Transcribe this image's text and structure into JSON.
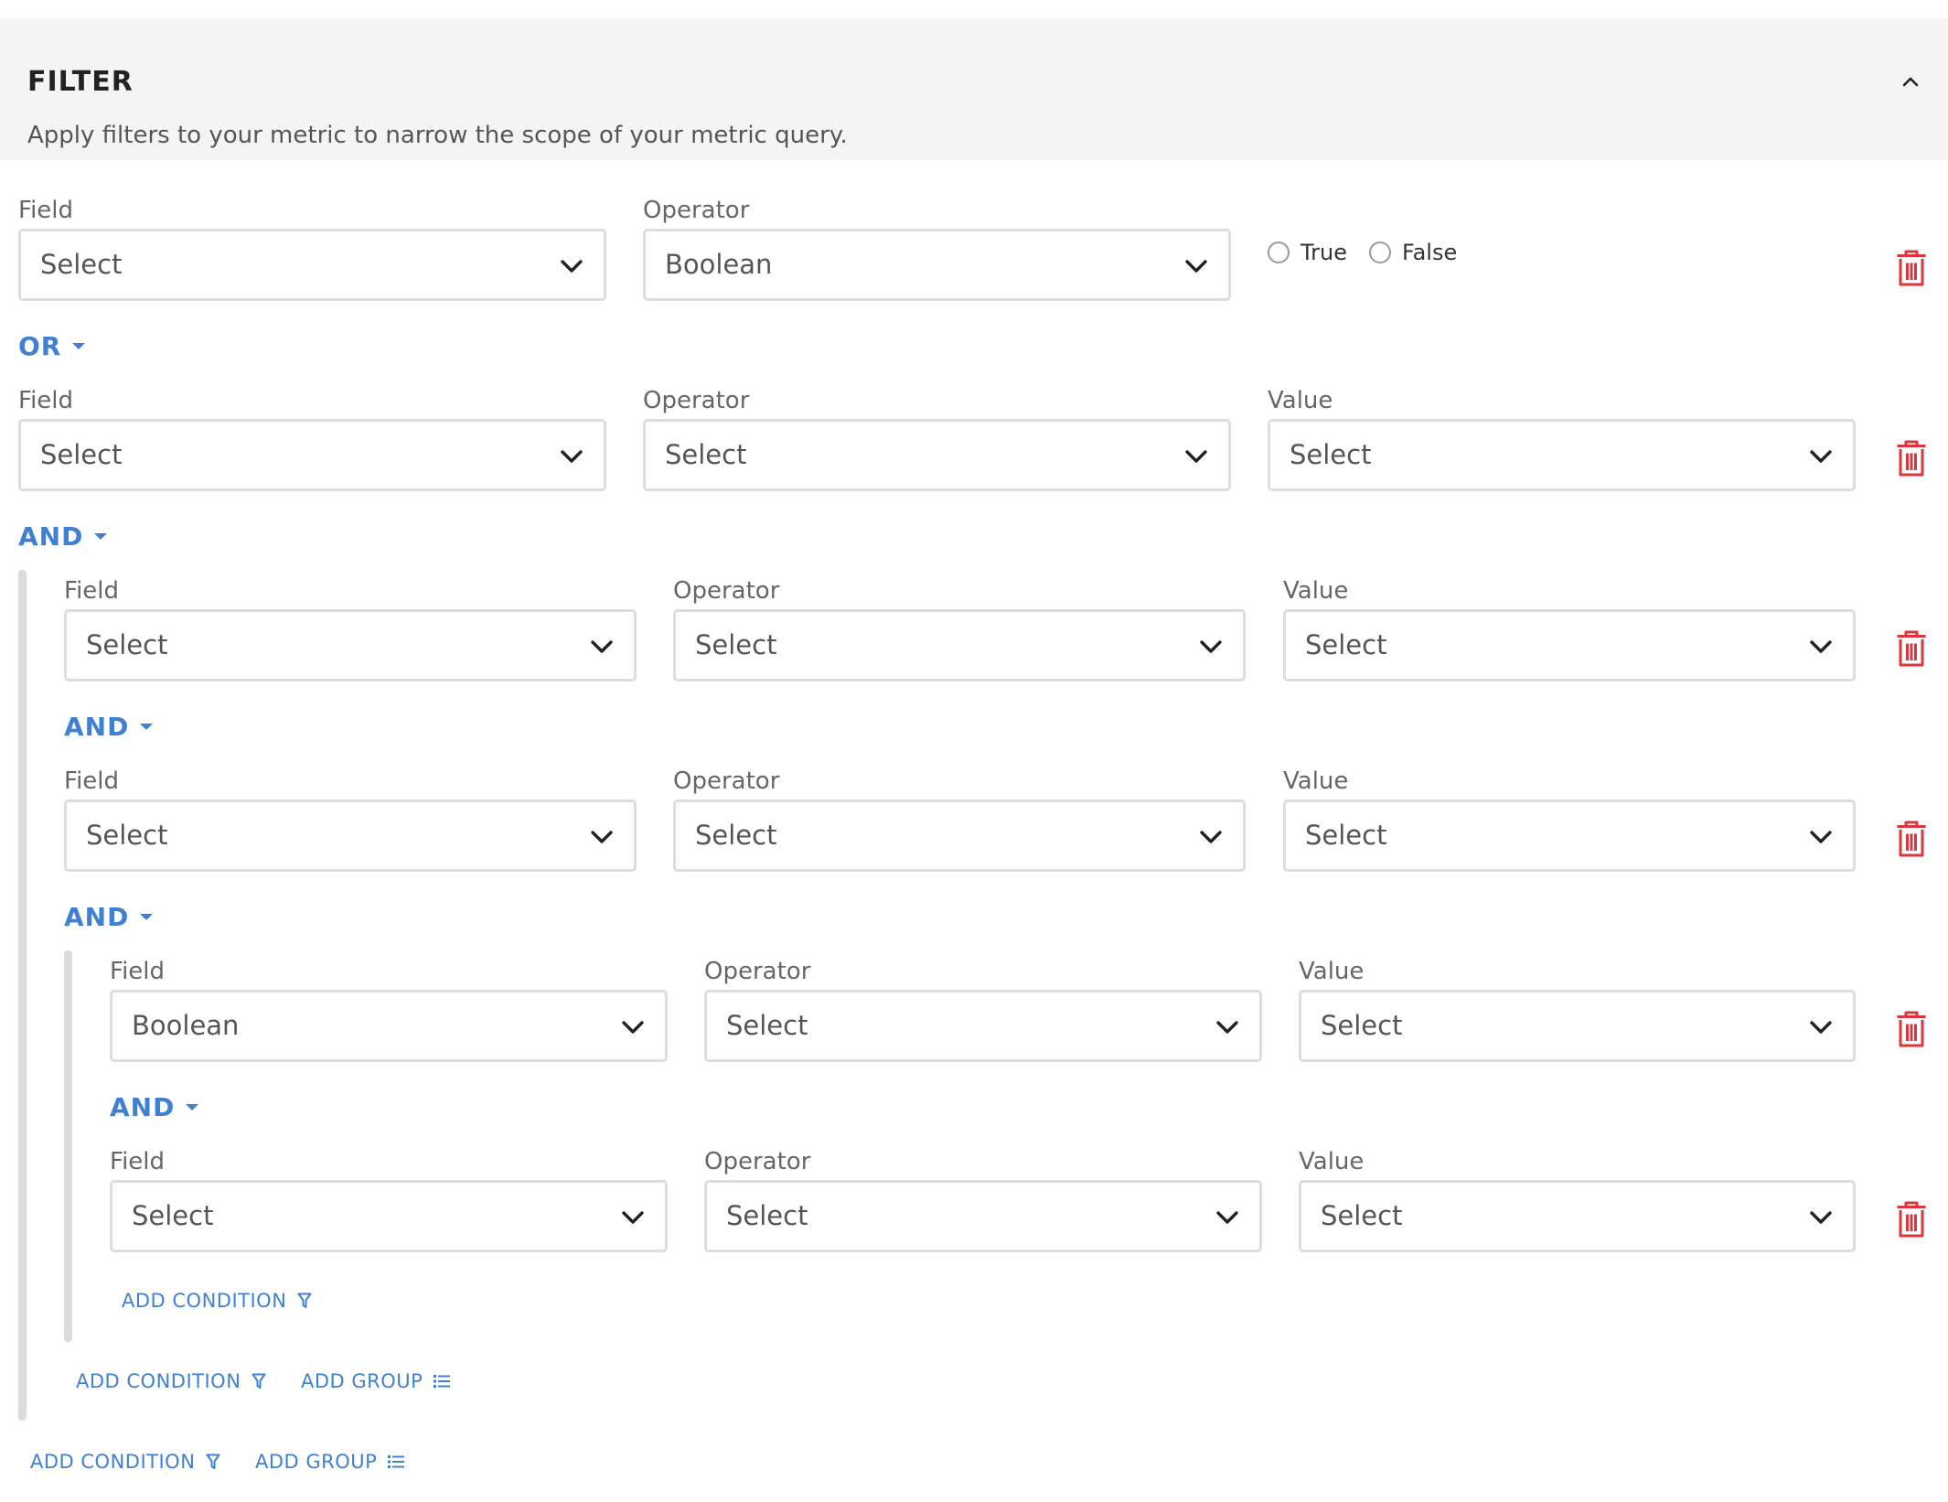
{
  "header": {
    "title": "FILTER",
    "description": "Apply filters to your metric to narrow the scope of your metric query."
  },
  "labels": {
    "field": "Field",
    "operator": "Operator",
    "value": "Value"
  },
  "rows": [
    {
      "field": "Select",
      "operator": "Boolean",
      "value_type": "radio",
      "radio": [
        "True",
        "False"
      ]
    },
    {
      "field": "Select",
      "operator": "Select",
      "value": "Select"
    },
    {
      "field": "Select",
      "operator": "Select",
      "value": "Select"
    },
    {
      "field": "Select",
      "operator": "Select",
      "value": "Select"
    },
    {
      "field": "Boolean",
      "operator": "Select",
      "value": "Select"
    },
    {
      "field": "Select",
      "operator": "Select",
      "value": "Select"
    }
  ],
  "conjunctions": [
    "OR",
    "AND",
    "AND",
    "AND",
    "AND"
  ],
  "actions": {
    "add_condition": "ADD CONDITION",
    "add_group": "ADD GROUP"
  },
  "colors": {
    "accent": "#3f80d4",
    "danger": "#d9363e",
    "header_bg": "#f4f4f4",
    "border": "#dddddd"
  }
}
